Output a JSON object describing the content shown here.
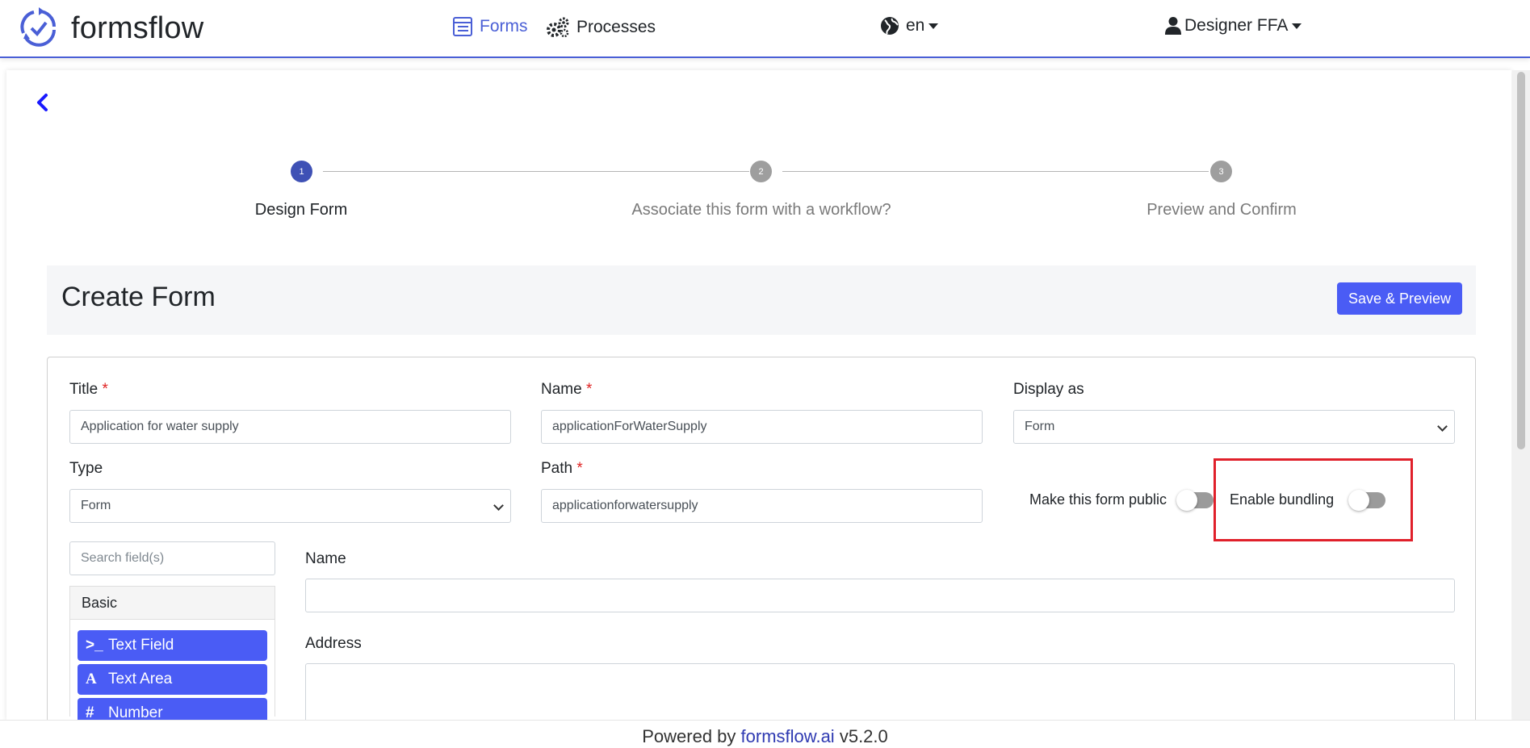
{
  "app": {
    "name": "formsflow"
  },
  "nav": {
    "forms_label": "Forms",
    "processes_label": "Processes",
    "language": "en",
    "user": "Designer FFA"
  },
  "stepper": {
    "steps": [
      {
        "number": "1",
        "label": "Design Form",
        "active": true
      },
      {
        "number": "2",
        "label": "Associate this form with a workflow?",
        "active": false
      },
      {
        "number": "3",
        "label": "Preview and Confirm",
        "active": false
      }
    ]
  },
  "header": {
    "title": "Create Form",
    "save_preview_label": "Save & Preview"
  },
  "form": {
    "title_label": "Title",
    "title_value": "Application for water supply",
    "name_label": "Name",
    "name_value": "applicationForWaterSupply",
    "display_as_label": "Display as",
    "display_as_value": "Form",
    "type_label": "Type",
    "type_value": "Form",
    "path_label": "Path",
    "path_value": "applicationforwatersupply",
    "required_mark": "*",
    "make_public_label": "Make this form public",
    "make_public_on": false,
    "enable_bundling_label": "Enable bundling",
    "enable_bundling_on": false
  },
  "builder": {
    "search_placeholder": "Search field(s)",
    "group_label": "Basic",
    "components": [
      {
        "icon": ">_",
        "label": "Text Field"
      },
      {
        "icon": "A",
        "label": "Text Area"
      },
      {
        "icon": "#",
        "label": "Number"
      }
    ],
    "canvas_fields": [
      {
        "label": "Name"
      },
      {
        "label": "Address"
      }
    ]
  },
  "footer": {
    "prefix": "Powered by",
    "link": "formsflow.ai",
    "version": "v5.2.0"
  },
  "colors": {
    "brand": "#4a5fd6",
    "primary_button": "#4a5cf5",
    "step_active": "#3f51b5",
    "highlight": "#e0202a"
  }
}
